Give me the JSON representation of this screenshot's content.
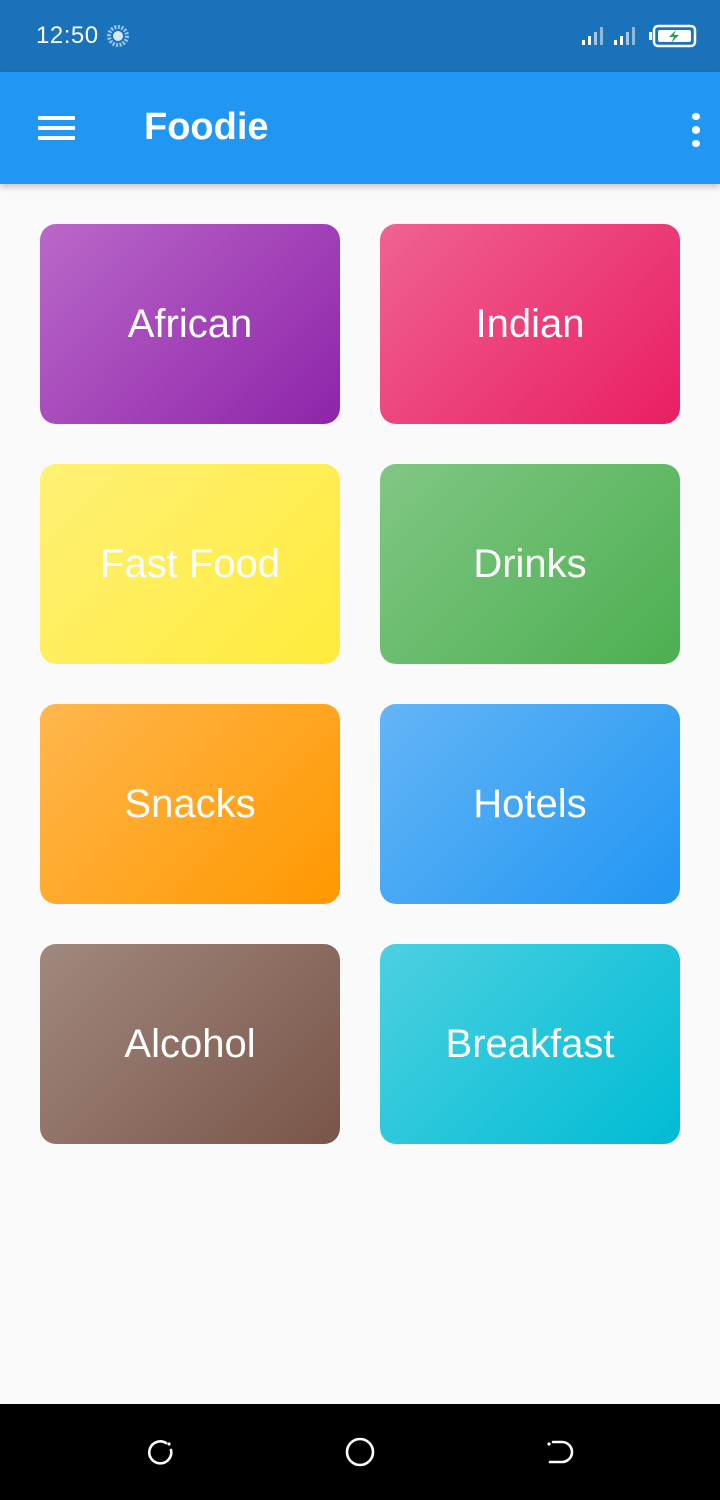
{
  "status_bar": {
    "time": "12:50",
    "icons": [
      "spinner-icon",
      "signal-icon",
      "signal-icon",
      "battery-charging-icon"
    ]
  },
  "app_bar": {
    "title": "Foodie",
    "menu_icon": "hamburger-menu-icon",
    "more_icon": "more-vert-icon",
    "color": "#2196f3"
  },
  "categories": [
    {
      "label": "African",
      "color_start": "#ba68c8",
      "color_end": "#8e24aa"
    },
    {
      "label": "Indian",
      "color_start": "#f06292",
      "color_end": "#e91e63"
    },
    {
      "label": "Fast Food",
      "color_start": "#fff176",
      "color_end": "#ffeb3b"
    },
    {
      "label": "Drinks",
      "color_start": "#81c784",
      "color_end": "#4caf50"
    },
    {
      "label": "Snacks",
      "color_start": "#ffb74d",
      "color_end": "#ff9800"
    },
    {
      "label": "Hotels",
      "color_start": "#64b5f6",
      "color_end": "#2196f3"
    },
    {
      "label": "Alcohol",
      "color_start": "#a1887f",
      "color_end": "#795548"
    },
    {
      "label": "Breakfast",
      "color_start": "#4dd0e1",
      "color_end": "#00bcd4"
    }
  ],
  "nav_bar": {
    "icons": [
      "recent-apps-icon",
      "home-icon",
      "back-icon"
    ]
  }
}
